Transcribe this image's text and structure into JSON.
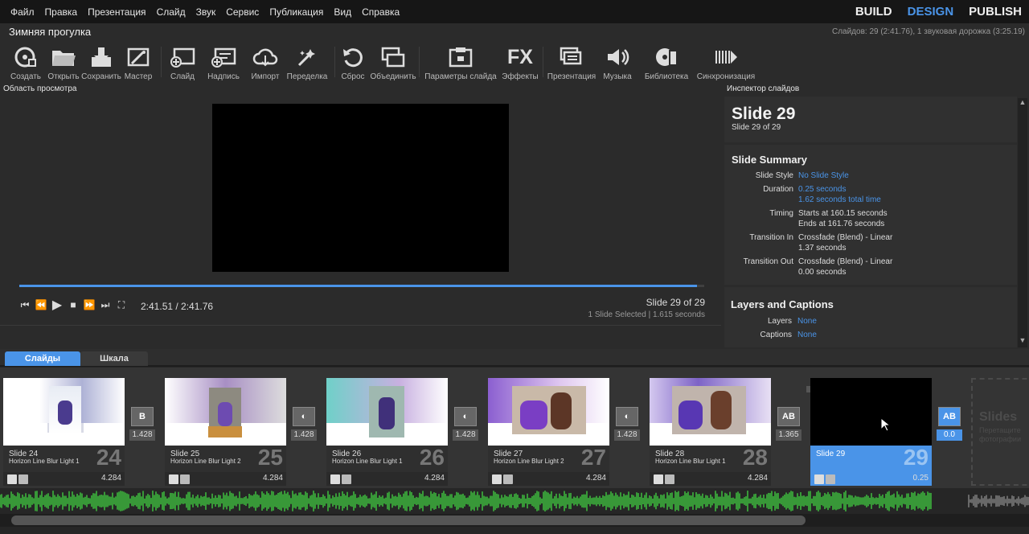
{
  "menu": [
    "Файл",
    "Правка",
    "Презентация",
    "Слайд",
    "Звук",
    "Сервис",
    "Публикация",
    "Вид",
    "Справка"
  ],
  "modes": [
    {
      "label": "BUILD",
      "active": false
    },
    {
      "label": "DESIGN",
      "active": true
    },
    {
      "label": "PUBLISH",
      "active": false
    }
  ],
  "project": {
    "title": "Зимняя прогулка",
    "status": "Слайдов: 29 (2:41.76), 1 звуковая дорожка (3:25.19)"
  },
  "toolbar": [
    {
      "label": "Создать",
      "icon": "create-icon"
    },
    {
      "label": "Открыть",
      "icon": "open-folder-icon"
    },
    {
      "label": "Сохранить",
      "icon": "save-icon"
    },
    {
      "label": "Мастер",
      "icon": "wizard-icon"
    },
    {
      "label": "Слайд",
      "icon": "add-slide-icon"
    },
    {
      "label": "Надпись",
      "icon": "caption-icon"
    },
    {
      "label": "Импорт",
      "icon": "import-icon"
    },
    {
      "label": "Переделка",
      "icon": "remix-icon"
    },
    {
      "label": "Сброс",
      "icon": "reset-icon"
    },
    {
      "label": "Объединить",
      "icon": "merge-icon"
    },
    {
      "label": "Параметры слайда",
      "icon": "slide-options-icon"
    },
    {
      "label": "Эффекты",
      "icon": "fx-icon"
    },
    {
      "label": "Презентация",
      "icon": "show-icon"
    },
    {
      "label": "Музыка",
      "icon": "music-icon"
    },
    {
      "label": "Библиотека",
      "icon": "library-icon"
    },
    {
      "label": "Синхронизация",
      "icon": "sync-icon"
    }
  ],
  "preview": {
    "title": "Область просмотра",
    "timecode": "2:41.51 / 2:41.76",
    "slide_position": "Slide 29 of 29",
    "selection_info": "1 Slide Selected  |  1.615 seconds",
    "progress": 0.99
  },
  "inspector": {
    "title": "Инспектор слайдов",
    "slide_title": "Slide 29",
    "slide_sub": "Slide 29 of 29",
    "summary_title": "Slide Summary",
    "slide_style_label": "Slide Style",
    "slide_style": "No Slide Style",
    "duration_label": "Duration",
    "duration_1": "0.25 seconds",
    "duration_2": "1.62 seconds total time",
    "timing_label": "Timing",
    "timing_1": "Starts at 160.15 seconds",
    "timing_2": "Ends at 161.76 seconds",
    "trans_in_label": "Transition In",
    "trans_in_1": "Crossfade (Blend) - Linear",
    "trans_in_2": "1.37 seconds",
    "trans_out_label": "Transition Out",
    "trans_out_1": "Crossfade (Blend) - Linear",
    "trans_out_2": "0.00 seconds",
    "layers_title": "Layers and Captions",
    "layers_label": "Layers",
    "layers": "None",
    "captions_label": "Captions",
    "captions": "None"
  },
  "tabs": [
    "Слайды",
    "Шкала"
  ],
  "slides": [
    {
      "name": "Slide 24",
      "style": "Horizon Line Blur Light 1",
      "num": "24",
      "dur": "4.284",
      "trans": "1.428",
      "trans_icon": "B"
    },
    {
      "name": "Slide 25",
      "style": "Horizon Line Blur Light 2",
      "num": "25",
      "dur": "4.284",
      "trans": "1.428",
      "trans_icon": "◐"
    },
    {
      "name": "Slide 26",
      "style": "Horizon Line Blur Light 1",
      "num": "26",
      "dur": "4.284",
      "trans": "1.428",
      "trans_icon": "◐"
    },
    {
      "name": "Slide 27",
      "style": "Horizon Line Blur Light 2",
      "num": "27",
      "dur": "4.284",
      "trans": "1.428",
      "trans_icon": "◐"
    },
    {
      "name": "Slide 28",
      "style": "Horizon Line Blur Light 1",
      "num": "28",
      "dur": "4.284",
      "trans": "1.365",
      "trans_icon": "AB"
    },
    {
      "name": "Slide 29",
      "style": "",
      "num": "29",
      "dur": "0.25",
      "trans": "0.0",
      "trans_icon": "AB"
    }
  ],
  "placeholder": {
    "title": "Slides",
    "sub": "Перетащите фотографии"
  },
  "colors": {
    "accent": "#4a94e8",
    "wave": "#3fbf3f"
  }
}
